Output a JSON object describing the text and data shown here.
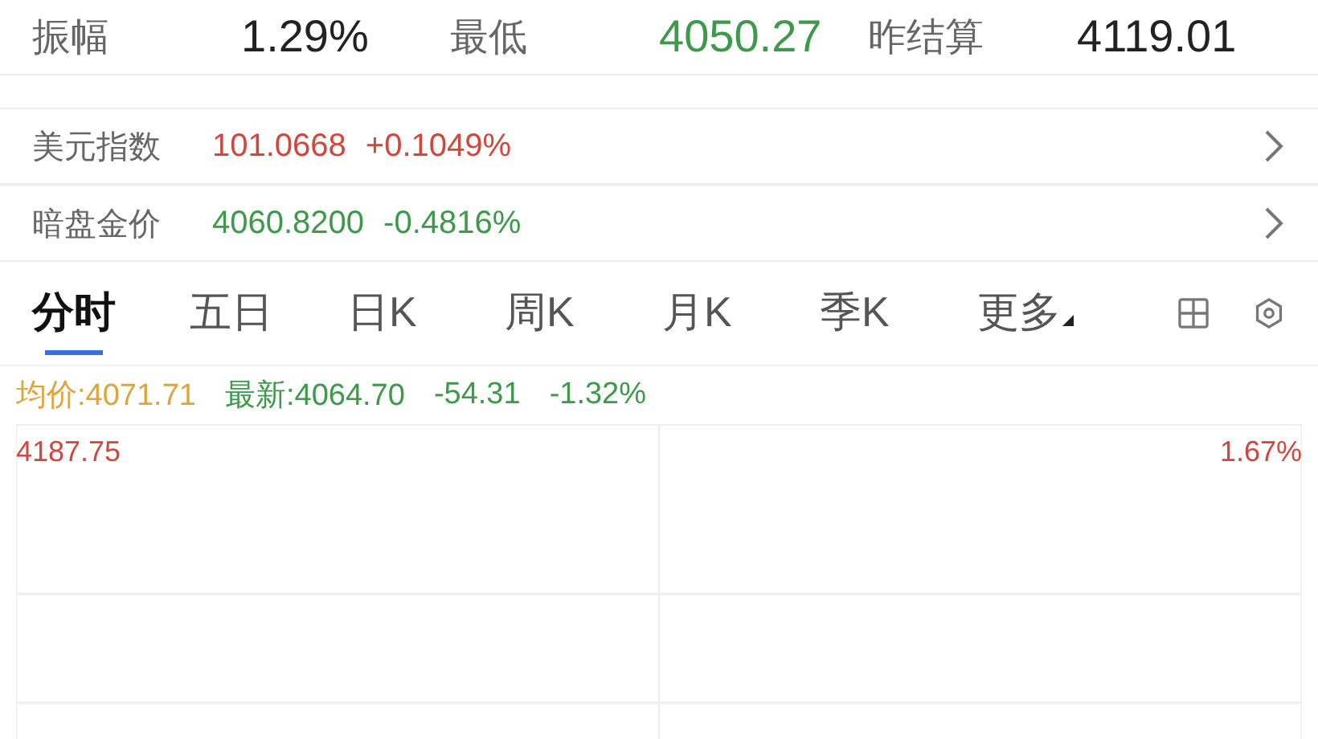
{
  "summary": [
    {
      "label": "振幅",
      "value": "1.29%",
      "color": "#222222"
    },
    {
      "label": "最低",
      "value": "4050.27",
      "color": "#3c9a4a"
    },
    {
      "label": "昨结算",
      "value": "4119.01",
      "color": "#222222"
    }
  ],
  "indices": [
    {
      "name": "美元指数",
      "value": "101.0668",
      "change": "+0.1049%",
      "color": "#d4463c"
    },
    {
      "name": "暗盘金价",
      "value": "4060.8200",
      "change": "-0.4816%",
      "color": "#3c9a4a"
    }
  ],
  "tabs": [
    {
      "label": "分时",
      "selected": true
    },
    {
      "label": "五日",
      "selected": false
    },
    {
      "label": "日K",
      "selected": false
    },
    {
      "label": "周K",
      "selected": false
    },
    {
      "label": "月K",
      "selected": false
    },
    {
      "label": "季K",
      "selected": false
    },
    {
      "label": "更多",
      "selected": false,
      "kind": "dropdown"
    }
  ],
  "chart_info": {
    "avg_label": "均价:4071.71",
    "latest_label": "最新:4064.70",
    "change": "-54.31",
    "change_pct": "-1.32%"
  },
  "chart": {
    "top_price": "4187.75",
    "top_pct": "1.67%"
  }
}
